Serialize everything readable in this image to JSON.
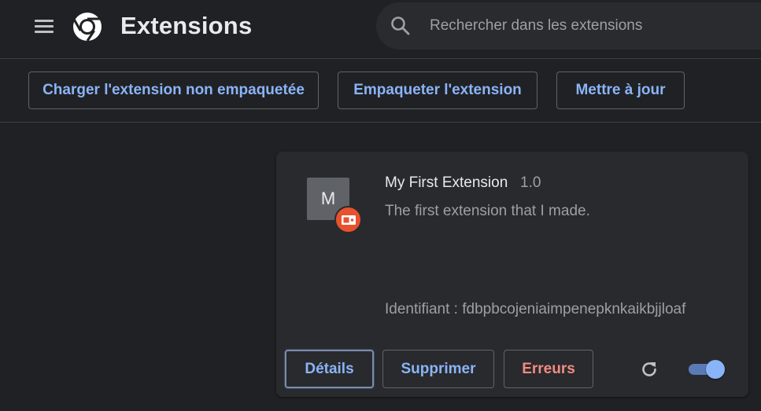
{
  "header": {
    "title": "Extensions",
    "menu_icon": "hamburger-menu-icon",
    "logo_icon": "chrome-logo-icon",
    "search": {
      "placeholder": "Rechercher dans les extensions",
      "value": "",
      "icon": "search-icon"
    }
  },
  "toolbar": {
    "load_unpacked_label": "Charger l'extension non empaquetée",
    "pack_label": "Empaqueter l'extension",
    "update_label": "Mettre à jour"
  },
  "extension": {
    "icon_letter": "M",
    "badge_icon": "developer-mode-badge-icon",
    "name": "My First Extension",
    "version": "1.0",
    "description": "The first extension that I made.",
    "id_label": "Identifiant : fdbpbcojeniaimpenepknkaikbjjloaf",
    "details_label": "Détails",
    "remove_label": "Supprimer",
    "errors_label": "Erreurs",
    "reload_icon": "reload-icon",
    "enabled": true
  },
  "colors": {
    "background": "#202124",
    "card": "#292a2d",
    "accent": "#8ab4f8",
    "error": "#f28b82",
    "badge": "#e8512e"
  }
}
